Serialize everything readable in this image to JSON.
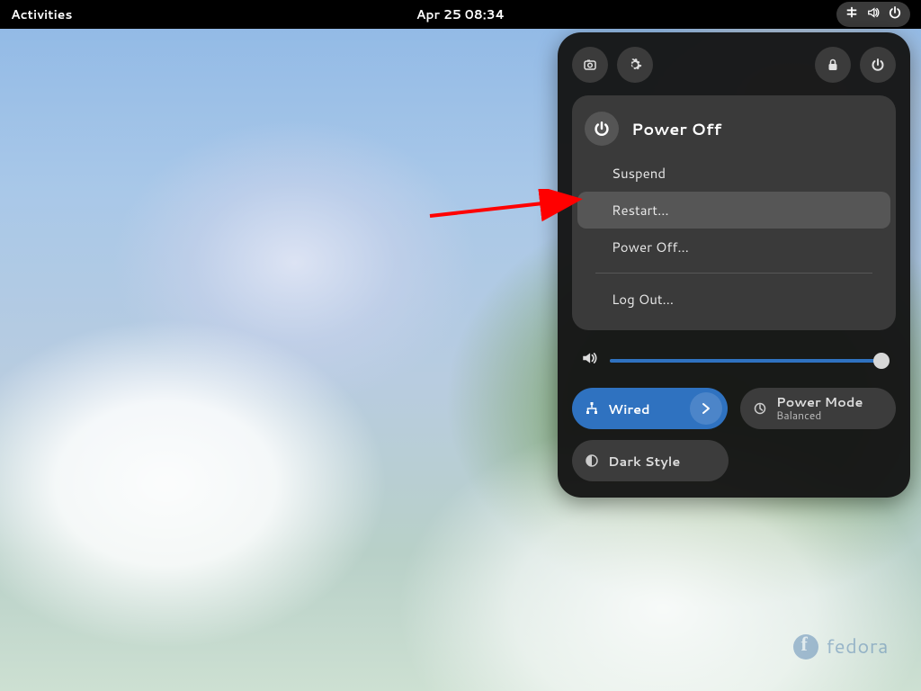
{
  "topbar": {
    "activities": "Activities",
    "datetime": "Apr 25  08:34"
  },
  "panel": {
    "power_title": "Power Off",
    "items": {
      "suspend": "Suspend",
      "restart": "Restart…",
      "poweroff": "Power Off…",
      "logout": "Log Out…"
    },
    "volume_percent": 98,
    "toggles": {
      "wired": {
        "label": "Wired"
      },
      "power_mode": {
        "label": "Power Mode",
        "sub": "Balanced"
      },
      "dark_style": {
        "label": "Dark Style"
      }
    }
  },
  "watermark": "fedora",
  "colors": {
    "accent": "#2f72c0"
  }
}
